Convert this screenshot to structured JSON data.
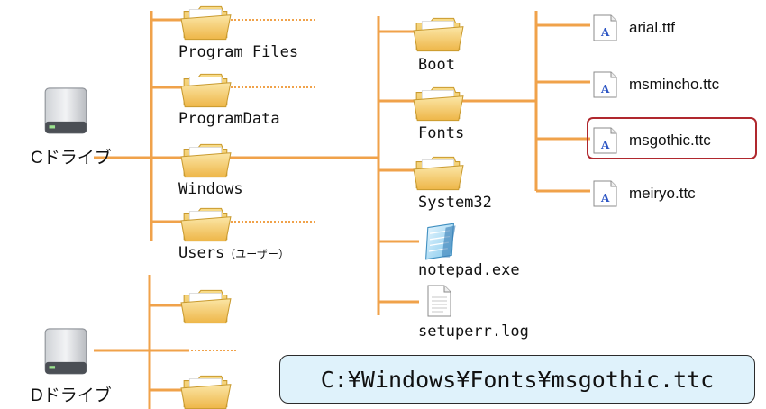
{
  "drives": {
    "c": {
      "label": "Cドライブ",
      "icon": "hard-drive-icon"
    },
    "d": {
      "label": "Dドライブ",
      "icon": "hard-drive-icon"
    }
  },
  "c_root": {
    "folders": [
      {
        "label": "Program Files"
      },
      {
        "label": "ProgramData"
      },
      {
        "label": "Windows"
      },
      {
        "label": "Users",
        "note": "（ユーザー）"
      }
    ]
  },
  "windows_dir": {
    "items": [
      {
        "label": "Boot",
        "icon": "folder-icon"
      },
      {
        "label": "Fonts",
        "icon": "folder-icon"
      },
      {
        "label": "System32",
        "icon": "folder-icon"
      },
      {
        "label": "notepad.exe",
        "icon": "notepad-icon"
      },
      {
        "label": "setuperr.log",
        "icon": "text-file-icon"
      }
    ]
  },
  "fonts_dir": {
    "files": [
      {
        "label": "arial.ttf",
        "icon": "font-file-icon"
      },
      {
        "label": "msmincho.ttc",
        "icon": "font-file-icon"
      },
      {
        "label": "msgothic.ttc",
        "icon": "font-file-icon",
        "highlighted": true
      },
      {
        "label": "meiryo.ttc",
        "icon": "font-file-icon"
      }
    ]
  },
  "path_box": {
    "text": "C:¥Windows¥Fonts¥msgothic.ttc"
  },
  "colors": {
    "connector": "#f0a24a",
    "folder": "#f2c94c",
    "highlight": "#b0282e",
    "path_box_bg": "#dff2fb"
  }
}
